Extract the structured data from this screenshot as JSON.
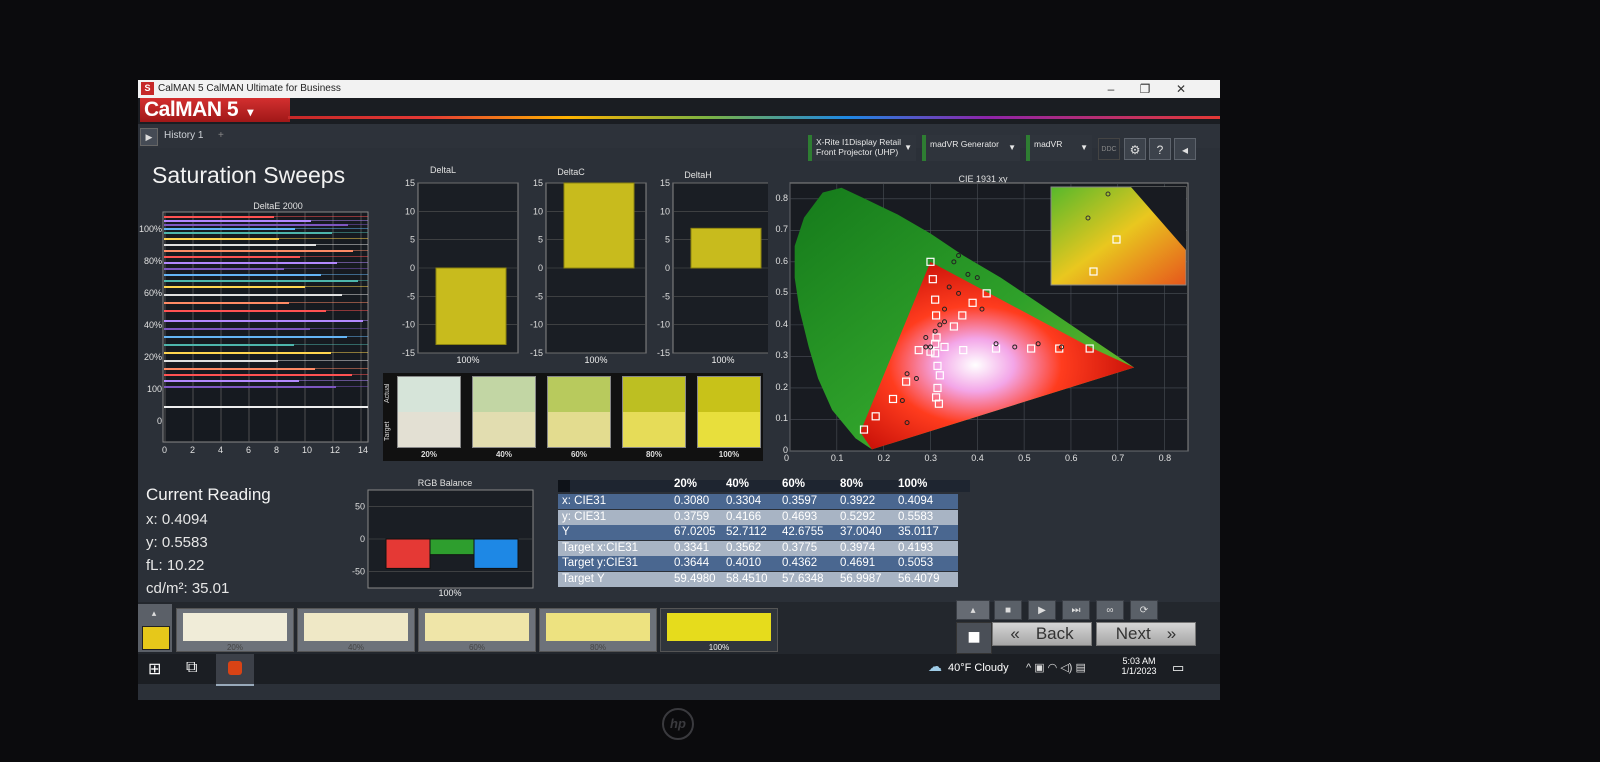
{
  "window": {
    "title": "CalMAN 5 CalMAN Ultimate for Business",
    "min": "–",
    "max": "❐",
    "close": "✕",
    "app_icon": "S"
  },
  "brand": {
    "name": "CalMAN 5",
    "dropdown": "▾"
  },
  "history": {
    "label": "History 1",
    "plus": "+",
    "play": "▶"
  },
  "toolbar": {
    "meter": {
      "line1": "X-Rite I1Display Retail",
      "line2": "Front Projector (UHP)"
    },
    "generator": "madVR Generator",
    "display": "madVR",
    "ddc_label": "DDC",
    "icons": [
      "gear-icon",
      "help-icon",
      "back-arrow-icon"
    ],
    "settings": "⚙",
    "help": "?",
    "collapse": "◂"
  },
  "page_title": "Saturation Sweeps",
  "charts": {
    "deltae": {
      "title": "DeltaE 2000",
      "xticks": [
        "0",
        "2",
        "4",
        "6",
        "8",
        "10",
        "12",
        "14"
      ],
      "yticks": [
        "100%",
        "80%",
        "60%",
        "40%",
        "20%",
        "100",
        "0"
      ]
    },
    "deltal": {
      "title": "DeltaL",
      "value": -13.5,
      "ylim": [
        -15,
        15
      ],
      "xlabel": "100%"
    },
    "deltac": {
      "title": "DeltaC",
      "value": 15,
      "ylim": [
        -15,
        15
      ],
      "xlabel": "100%"
    },
    "deltah": {
      "title": "DeltaH",
      "value": 7,
      "ylim": [
        -15,
        15
      ],
      "xlabel": "100%"
    },
    "yticks": [
      "15",
      "10",
      "5",
      "0",
      "-5",
      "-10",
      "-15"
    ],
    "cie": {
      "title": "CIE 1931 xy",
      "xticks": [
        "0",
        "0.1",
        "0.2",
        "0.3",
        "0.4",
        "0.5",
        "0.6",
        "0.7",
        "0.8"
      ],
      "yticks": [
        "0.8",
        "0.7",
        "0.6",
        "0.5",
        "0.4",
        "0.3",
        "0.2",
        "0.1",
        "0"
      ]
    },
    "rgb": {
      "title": "RGB Balance",
      "yticks": [
        "50",
        "0",
        "-50"
      ],
      "xlabel": "100%",
      "red": -45,
      "green": -24,
      "blue": -45
    }
  },
  "swatches": {
    "actual_label": "Actual",
    "target_label": "Target",
    "items": [
      {
        "label": "20%",
        "actual": "#d6e4d9",
        "target": "#e3e0d3"
      },
      {
        "label": "40%",
        "actual": "#c2d6a4",
        "target": "#e2ddb0"
      },
      {
        "label": "60%",
        "actual": "#b8ca5d",
        "target": "#e3dc8f"
      },
      {
        "label": "80%",
        "actual": "#bdbf22",
        "target": "#e6dc58"
      },
      {
        "label": "100%",
        "actual": "#c8c219",
        "target": "#e8df3c"
      }
    ]
  },
  "current": {
    "title": "Current Reading",
    "x": "x: 0.4094",
    "y": "y: 0.5583",
    "fl": "fL: 10.22",
    "cdm": "cd/m²: 35.01"
  },
  "table": {
    "headers": [
      "20%",
      "40%",
      "60%",
      "80%",
      "100%"
    ],
    "rows": [
      {
        "label": "x: CIE31",
        "values": [
          "0.3080",
          "0.3304",
          "0.3597",
          "0.3922",
          "0.4094"
        ]
      },
      {
        "label": "y: CIE31",
        "values": [
          "0.3759",
          "0.4166",
          "0.4693",
          "0.5292",
          "0.5583"
        ]
      },
      {
        "label": "Y",
        "values": [
          "67.0205",
          "52.7112",
          "42.6755",
          "37.0040",
          "35.0117"
        ]
      },
      {
        "label": "Target x:CIE31",
        "values": [
          "0.3341",
          "0.3562",
          "0.3775",
          "0.3974",
          "0.4193"
        ]
      },
      {
        "label": "Target y:CIE31",
        "values": [
          "0.3644",
          "0.4010",
          "0.4362",
          "0.4691",
          "0.5053"
        ]
      },
      {
        "label": "Target Y",
        "values": [
          "59.4980",
          "58.4510",
          "57.6348",
          "56.9987",
          "56.4079"
        ]
      }
    ]
  },
  "steps": [
    {
      "label": "20%",
      "color": "#f0ecd8"
    },
    {
      "label": "40%",
      "color": "#efe8c6"
    },
    {
      "label": "60%",
      "color": "#efe5a8"
    },
    {
      "label": "80%",
      "color": "#ede280"
    },
    {
      "label": "100%",
      "color": "#e6dc1c"
    }
  ],
  "current_swatch_color": "#e6c81a",
  "nav": {
    "back": "Back",
    "next": "Next",
    "back_icon": "«",
    "next_icon": "»"
  },
  "controls": {
    "stop": "■",
    "play": "▶",
    "step": "⏭",
    "loop": "∞",
    "refresh": "⟳",
    "up": "▴"
  },
  "taskbar": {
    "weather": "40°F  Cloudy",
    "time": "5:03 AM",
    "date": "1/1/2023",
    "tray": "^  ▣  ◠  ◁)  ▤",
    "notify": "▭",
    "start": "⊞",
    "taskview": "⧉"
  },
  "cie_points": {
    "targets": [
      [
        0.158,
        0.068
      ],
      [
        0.183,
        0.11
      ],
      [
        0.22,
        0.165
      ],
      [
        0.248,
        0.22
      ],
      [
        0.275,
        0.32
      ],
      [
        0.3,
        0.315
      ],
      [
        0.31,
        0.31
      ],
      [
        0.31,
        0.34
      ],
      [
        0.313,
        0.36
      ],
      [
        0.312,
        0.43
      ],
      [
        0.31,
        0.48
      ],
      [
        0.305,
        0.545
      ],
      [
        0.3,
        0.6
      ],
      [
        0.33,
        0.33
      ],
      [
        0.32,
        0.24
      ],
      [
        0.315,
        0.2
      ],
      [
        0.312,
        0.17
      ],
      [
        0.318,
        0.15
      ],
      [
        0.315,
        0.27
      ],
      [
        0.37,
        0.32
      ],
      [
        0.44,
        0.325
      ],
      [
        0.515,
        0.325
      ],
      [
        0.575,
        0.325
      ],
      [
        0.64,
        0.325
      ],
      [
        0.35,
        0.395
      ],
      [
        0.368,
        0.43
      ],
      [
        0.39,
        0.47
      ],
      [
        0.42,
        0.5
      ]
    ],
    "measured": [
      [
        0.25,
        0.245
      ],
      [
        0.24,
        0.16
      ],
      [
        0.25,
        0.09
      ],
      [
        0.27,
        0.23
      ],
      [
        0.29,
        0.33
      ],
      [
        0.3,
        0.33
      ],
      [
        0.32,
        0.4
      ],
      [
        0.33,
        0.41
      ],
      [
        0.34,
        0.52
      ],
      [
        0.35,
        0.6
      ],
      [
        0.36,
        0.62
      ],
      [
        0.4,
        0.55
      ],
      [
        0.41,
        0.45
      ],
      [
        0.44,
        0.34
      ],
      [
        0.48,
        0.33
      ],
      [
        0.53,
        0.34
      ],
      [
        0.58,
        0.33
      ],
      [
        0.29,
        0.36
      ],
      [
        0.31,
        0.38
      ],
      [
        0.33,
        0.45
      ],
      [
        0.36,
        0.5
      ],
      [
        0.38,
        0.56
      ]
    ]
  }
}
